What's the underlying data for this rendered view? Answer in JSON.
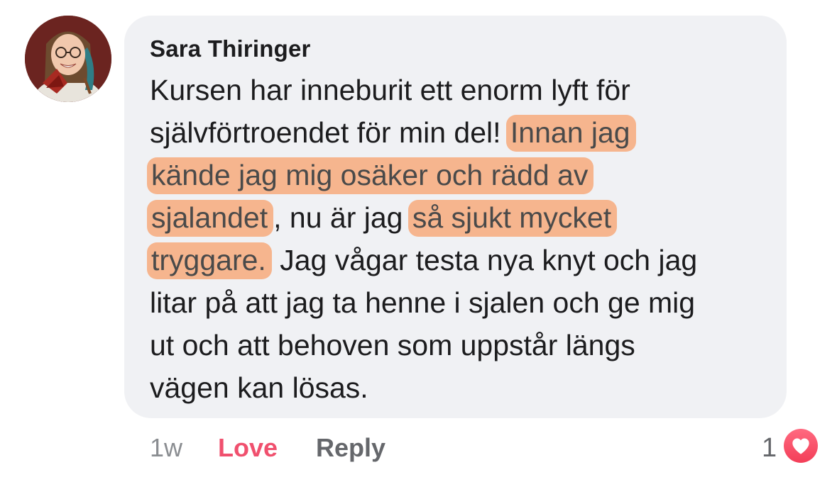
{
  "comment": {
    "author": "Sara Thiringer",
    "lines": [
      [
        {
          "t": "Kursen har inneburit ett enorm lyft för",
          "hl": false
        }
      ],
      [
        {
          "t": "självförtroendet för min del! ",
          "hl": false
        },
        {
          "t": "Innan jag",
          "hl": true
        }
      ],
      [
        {
          "t": "kände jag mig osäker och rädd av",
          "hl": true
        }
      ],
      [
        {
          "t": "sjalandet",
          "hl": true
        },
        {
          "t": ", nu är jag ",
          "hl": false
        },
        {
          "t": "så sjukt mycket",
          "hl": true
        }
      ],
      [
        {
          "t": "tryggare.",
          "hl": true
        },
        {
          "t": " Jag vågar testa nya knyt och jag",
          "hl": false
        }
      ],
      [
        {
          "t": "litar på att jag ta henne i sjalen och ge mig",
          "hl": false
        }
      ],
      [
        {
          "t": "ut och att behoven som uppstår längs",
          "hl": false
        }
      ],
      [
        {
          "t": "vägen kan lösas.",
          "hl": false
        }
      ]
    ],
    "highlight_color": "#f6b58e"
  },
  "actions": {
    "time": "1w",
    "love": "Love",
    "reply": "Reply"
  },
  "reactions": {
    "count": "1",
    "type_icon": "heart-icon",
    "color": "#f33e58"
  }
}
